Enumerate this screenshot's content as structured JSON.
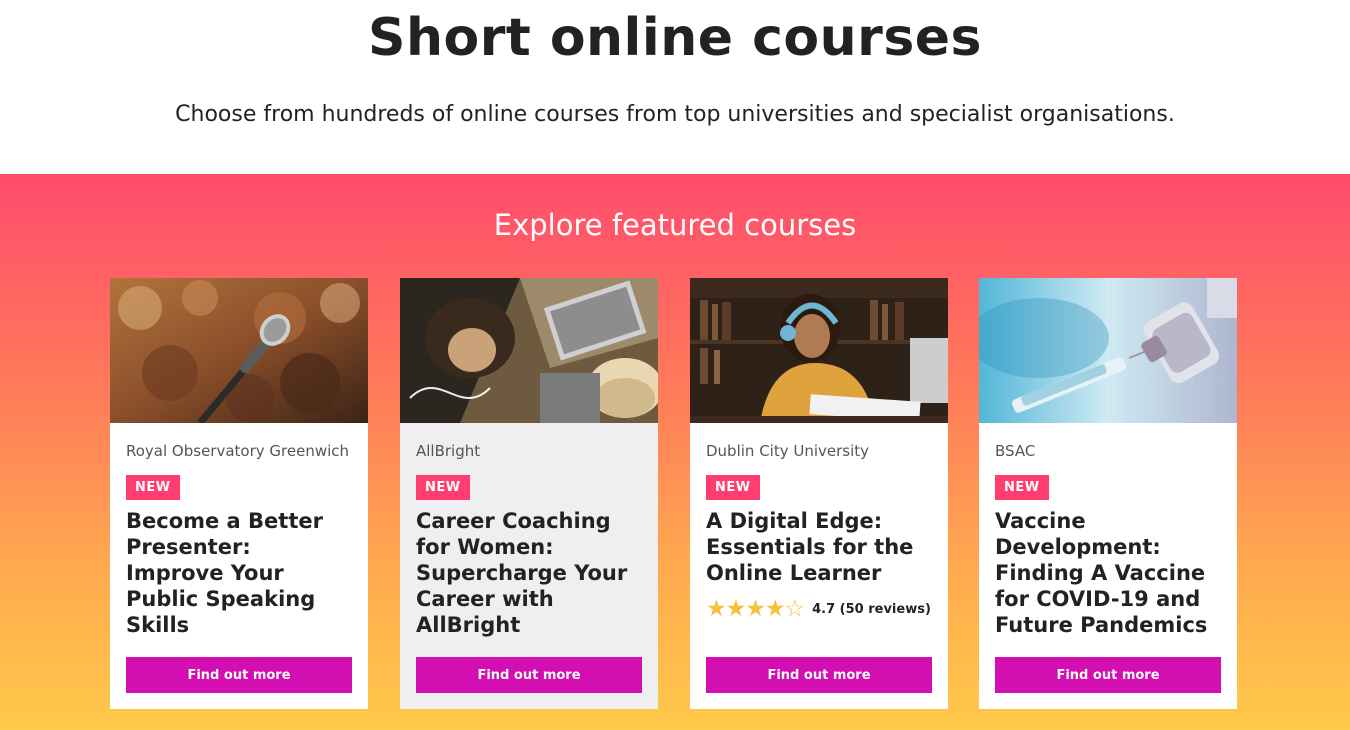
{
  "hero": {
    "title": "Short online courses",
    "subtitle": "Choose from hundreds of online courses from top universities and specialist organisations."
  },
  "featured": {
    "heading": "Explore featured courses",
    "cards": [
      {
        "image": "microphone-audience-photo",
        "provider": "Royal Observatory Greenwich",
        "badge": "NEW",
        "title": "Become a Better Presenter: Improve Your Public Speaking Skills",
        "cta": "Find out more"
      },
      {
        "image": "women-with-laptop-photo",
        "provider": "AllBright",
        "badge": "NEW",
        "title": "Career Coaching for Women: Supercharge Your Career with AllBright",
        "cta": "Find out more"
      },
      {
        "image": "student-with-headphones-photo",
        "provider": "Dublin City University",
        "badge": "NEW",
        "title": "A Digital Edge: Essentials for the Online Learner",
        "rating": {
          "stars": 4.5,
          "text": "4.7 (50 reviews)"
        },
        "cta": "Find out more"
      },
      {
        "image": "vaccine-syringe-photo",
        "provider": "BSAC",
        "badge": "NEW",
        "title": "Vaccine Development: Finding A Vaccine for COVID-19 and Future Pandemics",
        "cta": "Find out more"
      }
    ]
  },
  "colors": {
    "badge": "#ff3d6e",
    "cta": "#d40fb1",
    "star": "#f5c13a",
    "gradient_top": "#ff4b6d",
    "gradient_bottom": "#ffc94a"
  }
}
